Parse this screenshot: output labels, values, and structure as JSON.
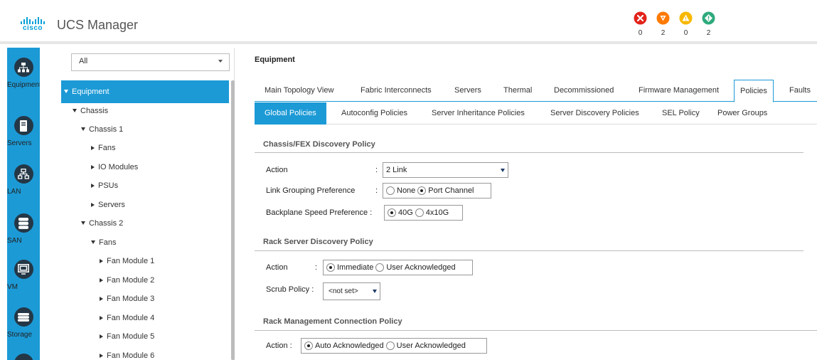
{
  "header": {
    "logo_text": "cisco",
    "app_title": "UCS Manager",
    "faults": [
      {
        "name": "critical",
        "count": "0",
        "color": "#e2231a"
      },
      {
        "name": "major",
        "count": "2",
        "color": "#ff7a00"
      },
      {
        "name": "minor",
        "count": "0",
        "color": "#f8b800"
      },
      {
        "name": "warning",
        "count": "2",
        "color": "#2eaa7c"
      }
    ]
  },
  "nav": {
    "items": [
      {
        "label": "Equipment",
        "icon": "equipment-icon"
      },
      {
        "label": "Servers",
        "icon": "servers-icon"
      },
      {
        "label": "LAN",
        "icon": "lan-icon"
      },
      {
        "label": "SAN",
        "icon": "san-icon"
      },
      {
        "label": "VM",
        "icon": "vm-icon"
      },
      {
        "label": "Storage",
        "icon": "storage-icon"
      }
    ]
  },
  "tree": {
    "filter_value": "All",
    "items": [
      "Equipment",
      "Chassis",
      "Chassis 1",
      "Fans",
      "IO Modules",
      "PSUs",
      "Servers",
      "Chassis 2",
      "Fans",
      "Fan Module 1",
      "Fan Module 2",
      "Fan Module 3",
      "Fan Module 4",
      "Fan Module 5",
      "Fan Module 6"
    ]
  },
  "main": {
    "title": "Equipment",
    "tabs": [
      "Main Topology View",
      "Fabric Interconnects",
      "Servers",
      "Thermal",
      "Decommissioned",
      "Firmware Management",
      "Policies",
      "Faults"
    ],
    "subtabs": [
      "Global Policies",
      "Autoconfig Policies",
      "Server Inheritance Policies",
      "Server Discovery Policies",
      "SEL Policy",
      "Power Groups"
    ],
    "chassis_section": {
      "title": "Chassis/FEX Discovery Policy",
      "action_label": "Action",
      "action_value": "2 Link",
      "link_grouping_label": "Link Grouping Preference",
      "link_grouping_options": [
        "None",
        "Port Channel"
      ],
      "backplane_label": "Backplane Speed Preference :",
      "backplane_options": [
        "40G",
        "4x10G"
      ]
    },
    "rack_discovery": {
      "title": "Rack Server Discovery Policy",
      "action_label": "Action",
      "action_options": [
        "Immediate",
        "User Acknowledged"
      ],
      "scrub_label": "Scrub Policy :",
      "scrub_value": "<not set>"
    },
    "rack_management": {
      "title": "Rack Management Connection Policy",
      "action_label": "Action :",
      "action_options": [
        "Auto Acknowledged",
        "User Acknowledged"
      ]
    },
    "colon": ":"
  }
}
